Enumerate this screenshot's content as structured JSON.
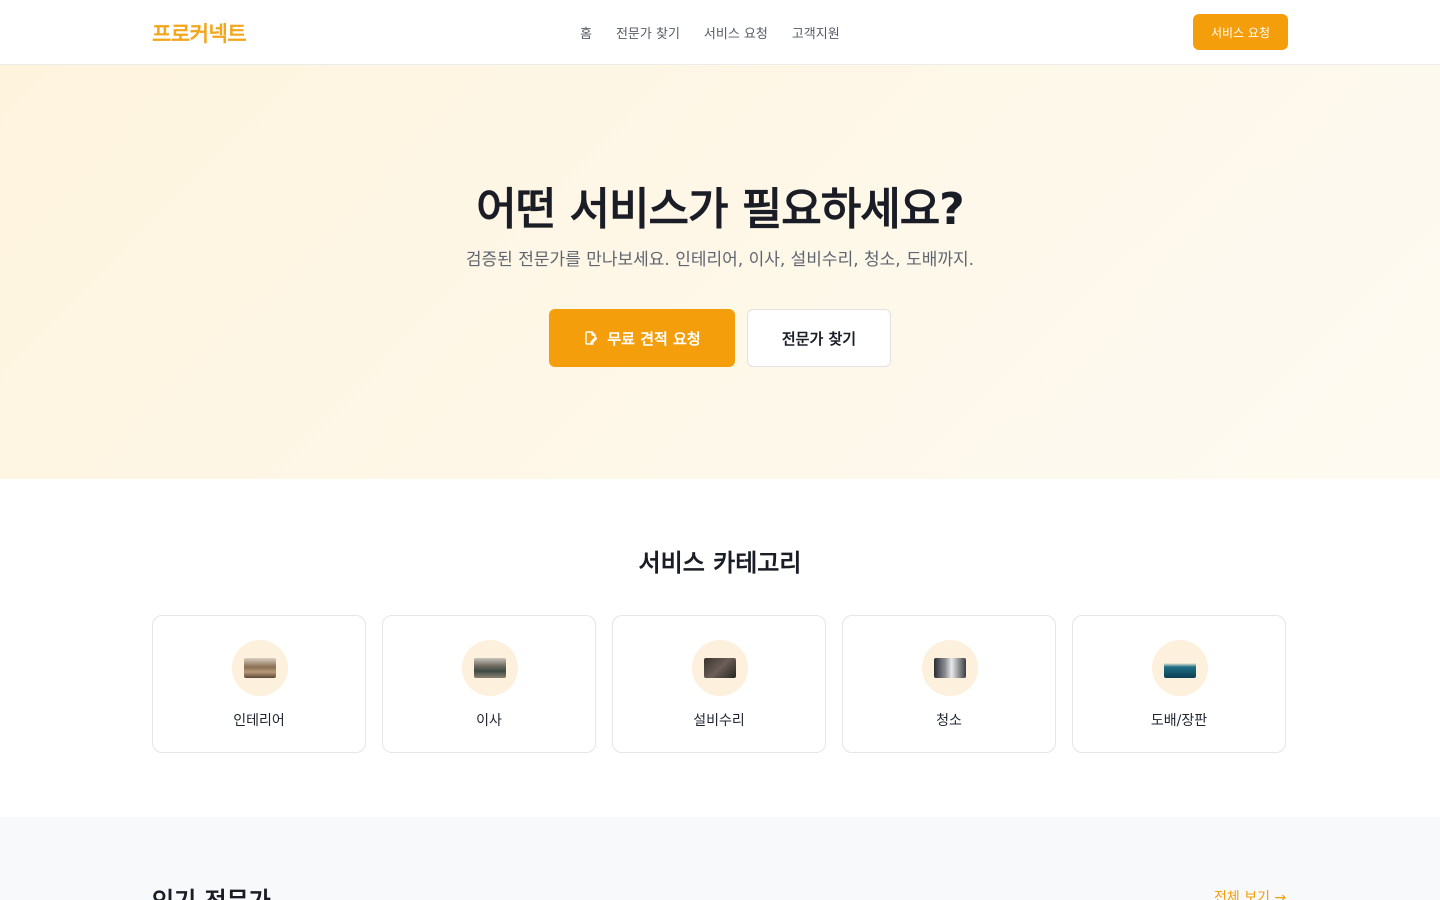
{
  "header": {
    "logo": "프로커넥트",
    "nav": [
      "홈",
      "전문가 찾기",
      "서비스 요청",
      "고객지원"
    ],
    "cta_label": "서비스 요청"
  },
  "hero": {
    "title": "어떤 서비스가 필요하세요?",
    "subtitle": "검증된 전문가를 만나보세요. 인테리어, 이사, 설비수리, 청소, 도배까지.",
    "primary_label": "무료 견적 요청",
    "primary_icon": "edit-icon",
    "secondary_label": "전문가 찾기"
  },
  "categories": {
    "title": "서비스 카테고리",
    "items": [
      {
        "label": "인테리어",
        "icon": "interior-thumbnail"
      },
      {
        "label": "이사",
        "icon": "moving-thumbnail"
      },
      {
        "label": "설비수리",
        "icon": "repair-thumbnail"
      },
      {
        "label": "청소",
        "icon": "cleaning-thumbnail"
      },
      {
        "label": "도배/장판",
        "icon": "wallpaper-thumbnail"
      }
    ]
  },
  "experts": {
    "title": "인기 전문가",
    "see_all": "전체 보기 →"
  },
  "colors": {
    "accent": "#f59e0b",
    "hero_bg": "#fef6e4",
    "icon_bg": "#fdf0dc"
  }
}
